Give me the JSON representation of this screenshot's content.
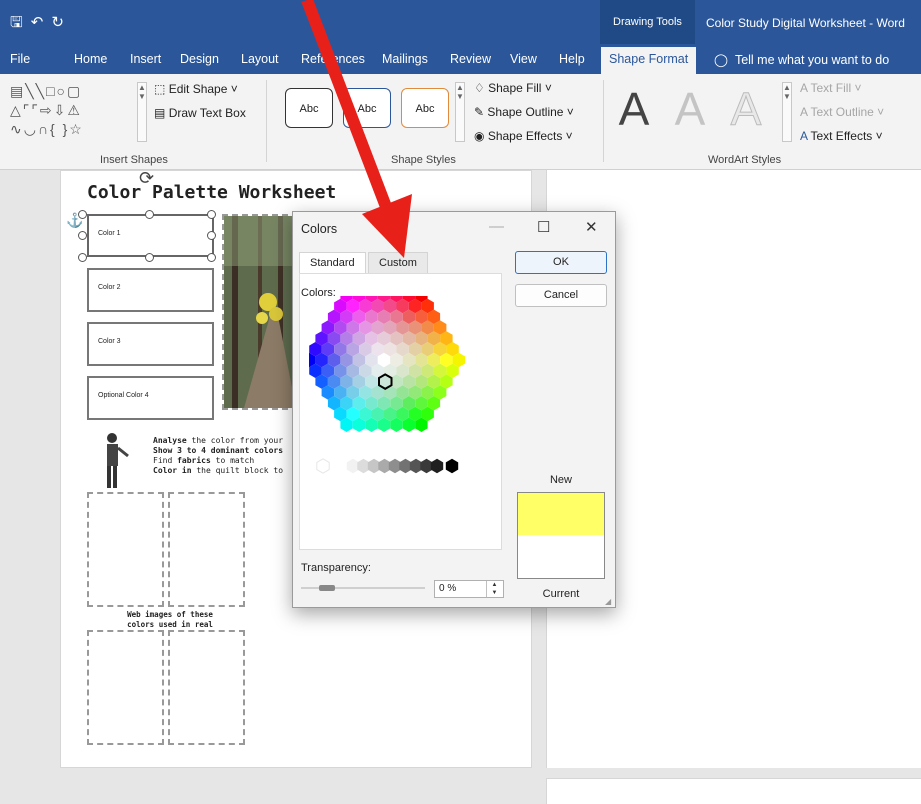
{
  "titlebar": {
    "context_tools": "Drawing Tools",
    "doc_title": "Color Study Digital Worksheet  -  Word"
  },
  "tabs": [
    "File",
    "Home",
    "Insert",
    "Design",
    "Layout",
    "References",
    "Mailings",
    "Review",
    "View",
    "Help"
  ],
  "active_tab": "Shape Format",
  "tell_me": "Tell me what you want to do",
  "ribbon": {
    "edit_shape": "Edit Shape",
    "draw_text_box": "Draw Text Box",
    "insert_shapes": "Insert Shapes",
    "style_sample": "Abc",
    "shape_fill": "Shape Fill",
    "shape_outline": "Shape Outline",
    "shape_effects": "Shape Effects",
    "shape_styles": "Shape Styles",
    "text_fill": "Text Fill",
    "text_outline": "Text Outline",
    "text_effects": "Text Effects",
    "wordart_styles": "WordArt Styles",
    "wordart_letter": "A"
  },
  "document": {
    "title": "Color Palette Worksheet",
    "color_boxes": [
      "Color 1",
      "Color 2",
      "Color 3",
      "Optional Color 4"
    ],
    "instructions": [
      [
        "Analyse",
        " the color from your"
      ],
      [
        "Show 3 to 4 dominant colors",
        ""
      ],
      [
        "Find ",
        "fabrics",
        " to match"
      ],
      [
        "Color in",
        " the quilt block to"
      ]
    ],
    "caption_line1": "Web images of these",
    "caption_line2": "colors used in real"
  },
  "dialog": {
    "title": "Colors",
    "tab_standard": "Standard",
    "tab_custom": "Custom",
    "colors_label": "Colors:",
    "ok": "OK",
    "cancel": "Cancel",
    "new_label": "New",
    "current_label": "Current",
    "transparency_label": "Transparency:",
    "transparency_value": "0 %",
    "new_color": "#ffff66",
    "current_color": "#ffffff"
  },
  "colors": {
    "word_blue": "#2b579a",
    "annotation_arrow": "#e8201a"
  }
}
